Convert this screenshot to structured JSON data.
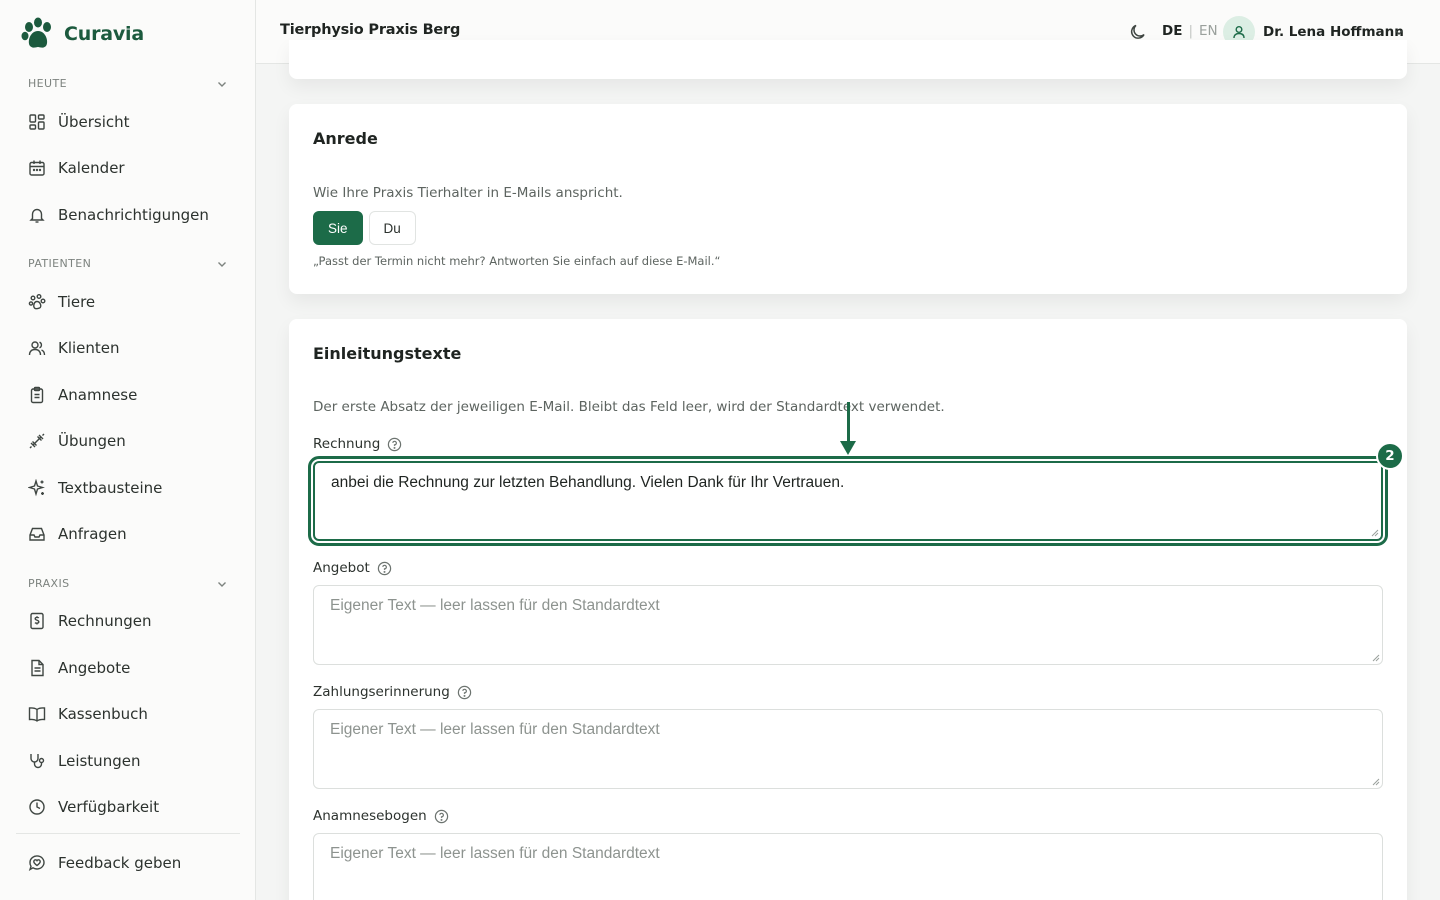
{
  "brand": {
    "name": "Curavia",
    "color": "#1c5a3e"
  },
  "sidebar": {
    "sections": [
      {
        "label": "HEUTE",
        "items": [
          {
            "label": "Übersicht",
            "icon": "dashboard-icon"
          },
          {
            "label": "Kalender",
            "icon": "calendar-icon"
          },
          {
            "label": "Benachrichtigungen",
            "icon": "bell-icon"
          }
        ]
      },
      {
        "label": "PATIENTEN",
        "items": [
          {
            "label": "Tiere",
            "icon": "paw-icon"
          },
          {
            "label": "Klienten",
            "icon": "users-icon"
          },
          {
            "label": "Anamnese",
            "icon": "clipboard-icon"
          },
          {
            "label": "Übungen",
            "icon": "dumbbell-icon"
          },
          {
            "label": "Textbausteine",
            "icon": "sparkles-icon"
          },
          {
            "label": "Anfragen",
            "icon": "inbox-icon"
          }
        ]
      },
      {
        "label": "PRAXIS",
        "items": [
          {
            "label": "Rechnungen",
            "icon": "invoice-icon"
          },
          {
            "label": "Angebote",
            "icon": "file-text-icon"
          },
          {
            "label": "Kassenbuch",
            "icon": "book-icon"
          },
          {
            "label": "Leistungen",
            "icon": "stethoscope-icon"
          },
          {
            "label": "Verfügbarkeit",
            "icon": "clock-icon"
          }
        ]
      }
    ],
    "feedback": "Feedback geben"
  },
  "header": {
    "practice_name": "Tierphysio Praxis Berg",
    "lang_active": "DE",
    "lang_sep": "|",
    "lang_inactive": "EN",
    "user_name": "Dr. Lena Hoffmann"
  },
  "anrede": {
    "title": "Anrede",
    "description": "Wie Ihre Praxis Tierhalter in E-Mails anspricht.",
    "options": [
      "Sie",
      "Du"
    ],
    "selected": "Sie",
    "preview": "„Passt der Termin nicht mehr? Antworten Sie einfach auf diese E-Mail.“"
  },
  "intro": {
    "title": "Einleitungstexte",
    "description": "Der erste Absatz der jeweiligen E-Mail. Bleibt das Feld leer, wird der Standardtext verwendet.",
    "fields": [
      {
        "label": "Rechnung",
        "value": "anbei die Rechnung zur letzten Behandlung. Vielen Dank für Ihr Vertrauen.",
        "placeholder": ""
      },
      {
        "label": "Angebot",
        "value": "",
        "placeholder": "Eigener Text — leer lassen für den Standardtext"
      },
      {
        "label": "Zahlungserinnerung",
        "value": "",
        "placeholder": "Eigener Text — leer lassen für den Standardtext"
      },
      {
        "label": "Anamnesebogen",
        "value": "",
        "placeholder": "Eigener Text — leer lassen für den Standardtext"
      }
    ]
  },
  "annotation": {
    "badge": "2"
  },
  "colors": {
    "accent": "#1c6b48",
    "accent_light": "#dceee4"
  }
}
